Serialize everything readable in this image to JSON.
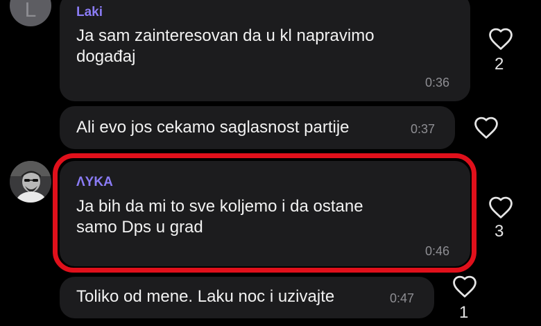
{
  "messages": [
    {
      "sender": "Laki",
      "avatar_letter": "L",
      "text": "Ja sam zainteresovan da u kl napravimo\ndogađaj",
      "time": "0:36",
      "likes": "2"
    },
    {
      "sender": "",
      "text": "Ali evo jos cekamo saglasnost partije",
      "time": "0:37",
      "likes": ""
    },
    {
      "sender": "ΛYKA",
      "text": "Ja bih da mi to sve koljemo i da ostane\nsamo Dps u grad",
      "time": "0:46",
      "likes": "3"
    },
    {
      "sender": "",
      "text": "Toliko od mene. Laku noc i uzivajte",
      "time": "0:47",
      "likes": "1"
    }
  ],
  "icons": {
    "like": "heart-outline-icon",
    "avatar_photo": "user-photo-avatar"
  },
  "colors": {
    "background": "#000000",
    "bubble": "#1c1c1e",
    "sender_name": "#8b7cf6",
    "highlight_border": "#e0101b",
    "timestamp": "#8e8e93"
  }
}
